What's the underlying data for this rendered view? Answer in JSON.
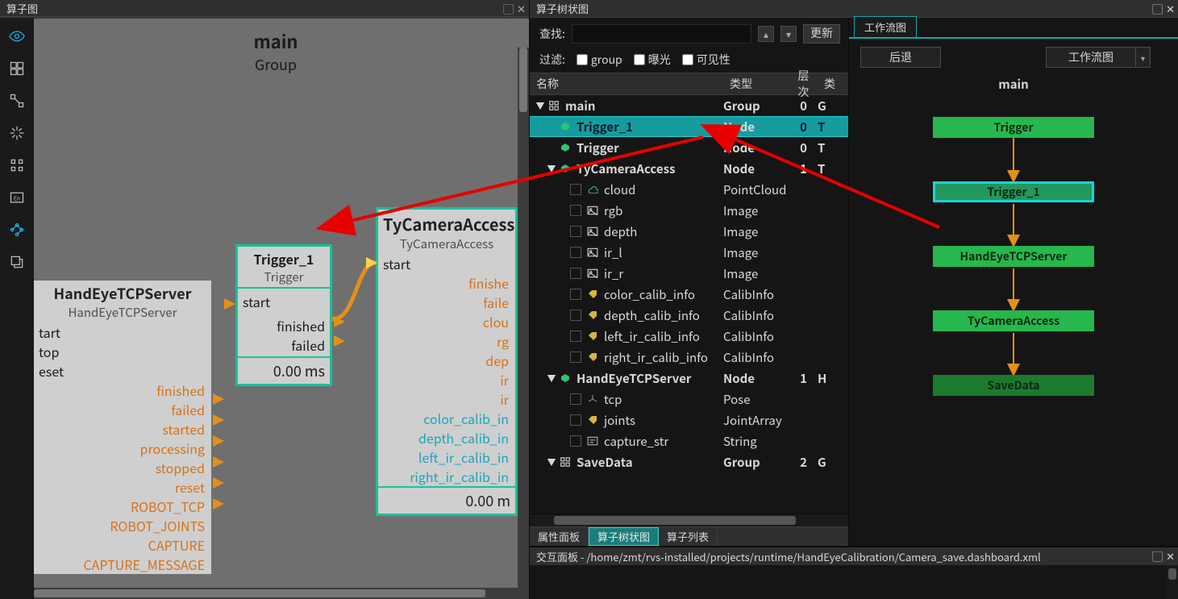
{
  "left": {
    "title": "算子图",
    "main": {
      "header": "main",
      "sub": "Group"
    },
    "trigger_node": {
      "title": "Trigger_1",
      "sub": "Trigger",
      "in": [
        "start"
      ],
      "out": [
        "finished",
        "failed"
      ],
      "foot": "0.00 ms"
    },
    "server_node": {
      "title": "HandEyeTCPServer",
      "sub": "HandEyeTCPServer",
      "in": [
        "tart",
        "top",
        "eset"
      ],
      "sig_out": [
        "finished",
        "failed",
        "started",
        "processing",
        "stopped",
        "reset"
      ],
      "data_out": [
        "ROBOT_TCP",
        "ROBOT_JOINTS",
        "CAPTURE",
        "CAPTURE_MESSAGE"
      ]
    },
    "camera_node": {
      "title": "TyCameraAccess",
      "sub": "TyCameraAccess",
      "in": [
        "start"
      ],
      "sig_out": [
        "finishe",
        "faile"
      ],
      "data_out": [
        "clou",
        "rg",
        "dep",
        "ir",
        "ir"
      ],
      "calib_out": [
        "color_calib_in",
        "depth_calib_in",
        "left_ir_calib_in",
        "right_ir_calib_in"
      ],
      "foot": "0.00 m"
    }
  },
  "tree": {
    "title": "算子树状图",
    "search_label": "查找:",
    "update": "更新",
    "filter_label": "过滤:",
    "filter_opts": [
      "group",
      "曝光",
      "可见性"
    ],
    "cols": {
      "name": "名称",
      "type": "类型",
      "lvl": "层次",
      "ext": "类"
    },
    "rows": [
      {
        "depth": 0,
        "exp": "▼",
        "ic": "group",
        "name": "main",
        "type": "Group",
        "lvl": "0",
        "ext": "G",
        "bold": true,
        "chk": false
      },
      {
        "depth": 1,
        "exp": "",
        "ic": "node",
        "name": "Trigger_1",
        "type": "Node",
        "lvl": "0",
        "ext": "T",
        "sel": true,
        "bold": true,
        "chk": false
      },
      {
        "depth": 1,
        "exp": "",
        "ic": "node",
        "name": "Trigger",
        "type": "Node",
        "lvl": "0",
        "ext": "T",
        "bold": true,
        "chk": false
      },
      {
        "depth": 1,
        "exp": "▼",
        "ic": "node",
        "name": "TyCameraAccess",
        "type": "Node",
        "lvl": "1",
        "ext": "T",
        "bold": true,
        "chk": false
      },
      {
        "depth": 2,
        "exp": "",
        "ic": "pc",
        "name": "cloud",
        "type": "PointCloud",
        "lvl": "",
        "ext": "",
        "chk": true
      },
      {
        "depth": 2,
        "exp": "",
        "ic": "img",
        "name": "rgb",
        "type": "Image",
        "lvl": "",
        "ext": "",
        "chk": true
      },
      {
        "depth": 2,
        "exp": "",
        "ic": "img",
        "name": "depth",
        "type": "Image",
        "lvl": "",
        "ext": "",
        "chk": true
      },
      {
        "depth": 2,
        "exp": "",
        "ic": "img",
        "name": "ir_l",
        "type": "Image",
        "lvl": "",
        "ext": "",
        "chk": true
      },
      {
        "depth": 2,
        "exp": "",
        "ic": "img",
        "name": "ir_r",
        "type": "Image",
        "lvl": "",
        "ext": "",
        "chk": true
      },
      {
        "depth": 2,
        "exp": "",
        "ic": "tag",
        "name": "color_calib_info",
        "type": "CalibInfo",
        "lvl": "",
        "ext": "",
        "chk": true
      },
      {
        "depth": 2,
        "exp": "",
        "ic": "tag",
        "name": "depth_calib_info",
        "type": "CalibInfo",
        "lvl": "",
        "ext": "",
        "chk": true
      },
      {
        "depth": 2,
        "exp": "",
        "ic": "tag",
        "name": "left_ir_calib_info",
        "type": "CalibInfo",
        "lvl": "",
        "ext": "",
        "chk": true
      },
      {
        "depth": 2,
        "exp": "",
        "ic": "tag",
        "name": "right_ir_calib_info",
        "type": "CalibInfo",
        "lvl": "",
        "ext": "",
        "chk": true
      },
      {
        "depth": 1,
        "exp": "▼",
        "ic": "node",
        "name": "HandEyeTCPServer",
        "type": "Node",
        "lvl": "1",
        "ext": "H",
        "bold": true,
        "chk": false
      },
      {
        "depth": 2,
        "exp": "",
        "ic": "pose",
        "name": "tcp",
        "type": "Pose",
        "lvl": "",
        "ext": "",
        "chk": true
      },
      {
        "depth": 2,
        "exp": "",
        "ic": "tag",
        "name": "joints",
        "type": "JointArray",
        "lvl": "",
        "ext": "",
        "chk": true
      },
      {
        "depth": 2,
        "exp": "",
        "ic": "str",
        "name": "capture_str",
        "type": "String",
        "lvl": "",
        "ext": "",
        "chk": true
      },
      {
        "depth": 1,
        "exp": "▼",
        "ic": "group",
        "name": "SaveData",
        "type": "Group",
        "lvl": "2",
        "ext": "G",
        "bold": true,
        "chk": false
      }
    ],
    "bottom_tabs": [
      "属性面板",
      "算子树状图",
      "算子列表"
    ],
    "active_bottom_tab": 1
  },
  "workflow": {
    "tab": "工作流图",
    "back": "后退",
    "select": "工作流图",
    "title": "main",
    "nodes": [
      {
        "label": "Trigger",
        "sel": false
      },
      {
        "label": "Trigger_1",
        "sel": true
      },
      {
        "label": "HandEyeTCPServer",
        "sel": false
      },
      {
        "label": "TyCameraAccess",
        "sel": false
      },
      {
        "label": "SaveData",
        "sel": false,
        "dark": true
      }
    ]
  },
  "inter": {
    "title": "交互面板 - /home/zmt/rvs-installed/projects/runtime/HandEyeCalibration/Camera_save.dashboard.xml"
  }
}
